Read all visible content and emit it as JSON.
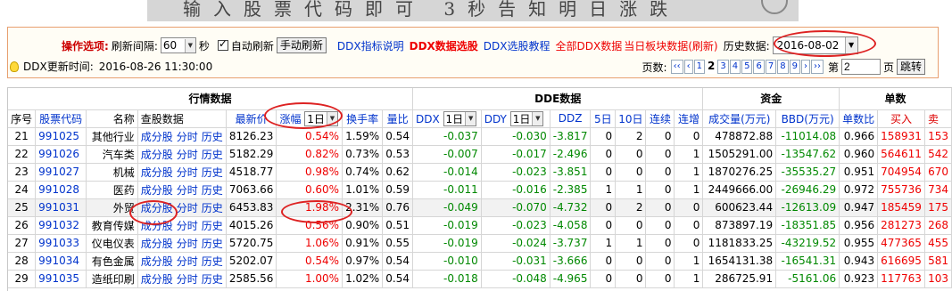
{
  "banner": {
    "text": "输入股票代码即可 3秒告知明日涨跌"
  },
  "controls": {
    "op_label": "操作选项:",
    "interval_label": "刷新间隔:",
    "interval_value": "60",
    "interval_unit": "秒",
    "auto_refresh_label": "自动刷新",
    "manual_refresh": "手动刷新",
    "links": [
      "DDX指标说明",
      "DDX数据选股",
      "DDX选股教程",
      "全部DDX数据",
      "当日板块数据(刷新)"
    ],
    "history_label": "历史数据:",
    "history_date": "2016-08-02",
    "update_label": "DDX更新时间:",
    "update_time": "2016-08-26 11:30:00"
  },
  "pager": {
    "label": "页数:",
    "first": "‹‹",
    "prev": "‹",
    "pages": [
      "1",
      "2",
      "3",
      "4",
      "5",
      "6",
      "7",
      "8",
      "9"
    ],
    "current": "2",
    "next": "›",
    "last": "››",
    "goto_prefix": "第",
    "goto_value": "2",
    "goto_suffix": "页",
    "goto_button": "跳转"
  },
  "table": {
    "groups": [
      "行情数据",
      "DDE数据",
      "资金",
      "单数"
    ],
    "headers": {
      "seq": "序号",
      "code": "股票代码",
      "name": "名称",
      "view": "查股数据",
      "price": "最新价",
      "change": "涨幅",
      "period": "1日",
      "turnover": "换手率",
      "vol_ratio": "量比",
      "ddx": "DDX",
      "ddx_period": "1日",
      "ddy": "DDY",
      "ddy_period": "1日",
      "ddz": "DDZ",
      "d5": "5日",
      "d10": "10日",
      "streak": "连续",
      "increase": "连增",
      "volume": "成交量(万元)",
      "bbd": "BBD(万元)",
      "ratio": "单数比",
      "buy": "买入",
      "sell": "卖"
    },
    "link_labels": [
      "成分股",
      "分时",
      "历史"
    ],
    "rows": [
      {
        "seq": "21",
        "code": "991025",
        "name": "其他行业",
        "price": "8126.23",
        "change": "0.54%",
        "turnover": "1.59%",
        "vol_ratio": "0.54",
        "ddx": "-0.037",
        "ddy": "-0.030",
        "ddz": "-3.817",
        "d5": "0",
        "d10": "2",
        "streak": "0",
        "increase": "0",
        "volume": "478872.88",
        "bbd": "-11014.08",
        "ratio": "0.966",
        "buy": "158931",
        "sell": "153"
      },
      {
        "seq": "22",
        "code": "991026",
        "name": "汽车类",
        "price": "5182.29",
        "change": "0.82%",
        "turnover": "0.73%",
        "vol_ratio": "0.53",
        "ddx": "-0.007",
        "ddy": "-0.017",
        "ddz": "-2.496",
        "d5": "0",
        "d10": "0",
        "streak": "0",
        "increase": "1",
        "volume": "1505291.00",
        "bbd": "-13547.62",
        "ratio": "0.960",
        "buy": "564611",
        "sell": "542"
      },
      {
        "seq": "23",
        "code": "991027",
        "name": "机械",
        "price": "4518.77",
        "change": "0.98%",
        "turnover": "0.74%",
        "vol_ratio": "0.62",
        "ddx": "-0.014",
        "ddy": "-0.023",
        "ddz": "-3.851",
        "d5": "0",
        "d10": "0",
        "streak": "0",
        "increase": "1",
        "volume": "1870276.25",
        "bbd": "-35535.27",
        "ratio": "0.951",
        "buy": "704954",
        "sell": "670"
      },
      {
        "seq": "24",
        "code": "991028",
        "name": "医药",
        "price": "7063.66",
        "change": "0.60%",
        "turnover": "1.01%",
        "vol_ratio": "0.59",
        "ddx": "-0.011",
        "ddy": "-0.016",
        "ddz": "-2.385",
        "d5": "1",
        "d10": "1",
        "streak": "0",
        "increase": "1",
        "volume": "2449666.00",
        "bbd": "-26946.29",
        "ratio": "0.972",
        "buy": "755736",
        "sell": "734"
      },
      {
        "seq": "25",
        "code": "991031",
        "name": "外贸",
        "price": "6453.83",
        "change": "1.98%",
        "turnover": "2.31%",
        "vol_ratio": "0.76",
        "ddx": "-0.049",
        "ddy": "-0.070",
        "ddz": "-4.732",
        "d5": "0",
        "d10": "2",
        "streak": "0",
        "increase": "0",
        "volume": "600623.44",
        "bbd": "-12613.09",
        "ratio": "0.947",
        "buy": "185459",
        "sell": "175"
      },
      {
        "seq": "26",
        "code": "991032",
        "name": "教育传媒",
        "price": "4015.26",
        "change": "0.56%",
        "turnover": "0.90%",
        "vol_ratio": "0.51",
        "ddx": "-0.019",
        "ddy": "-0.023",
        "ddz": "-4.058",
        "d5": "0",
        "d10": "0",
        "streak": "0",
        "increase": "0",
        "volume": "873897.19",
        "bbd": "-18351.85",
        "ratio": "0.956",
        "buy": "281273",
        "sell": "268"
      },
      {
        "seq": "27",
        "code": "991033",
        "name": "仪电仪表",
        "price": "5720.75",
        "change": "1.06%",
        "turnover": "0.91%",
        "vol_ratio": "0.55",
        "ddx": "-0.019",
        "ddy": "-0.024",
        "ddz": "-3.737",
        "d5": "1",
        "d10": "1",
        "streak": "0",
        "increase": "0",
        "volume": "1181833.25",
        "bbd": "-43219.52",
        "ratio": "0.955",
        "buy": "477365",
        "sell": "455"
      },
      {
        "seq": "28",
        "code": "991034",
        "name": "有色金属",
        "price": "5202.07",
        "change": "0.54%",
        "turnover": "0.97%",
        "vol_ratio": "0.54",
        "ddx": "-0.010",
        "ddy": "-0.031",
        "ddz": "-3.666",
        "d5": "0",
        "d10": "0",
        "streak": "0",
        "increase": "1",
        "volume": "1654131.38",
        "bbd": "-16541.31",
        "ratio": "0.943",
        "buy": "616695",
        "sell": "581"
      },
      {
        "seq": "29",
        "code": "991035",
        "name": "造纸印刷",
        "price": "2585.56",
        "change": "1.00%",
        "turnover": "1.02%",
        "vol_ratio": "0.54",
        "ddx": "-0.018",
        "ddy": "-0.048",
        "ddz": "-4.965",
        "d5": "0",
        "d10": "0",
        "streak": "0",
        "increase": "1",
        "volume": "286725.91",
        "bbd": "-5161.06",
        "ratio": "0.923",
        "buy": "117763",
        "sell": "103"
      }
    ]
  }
}
